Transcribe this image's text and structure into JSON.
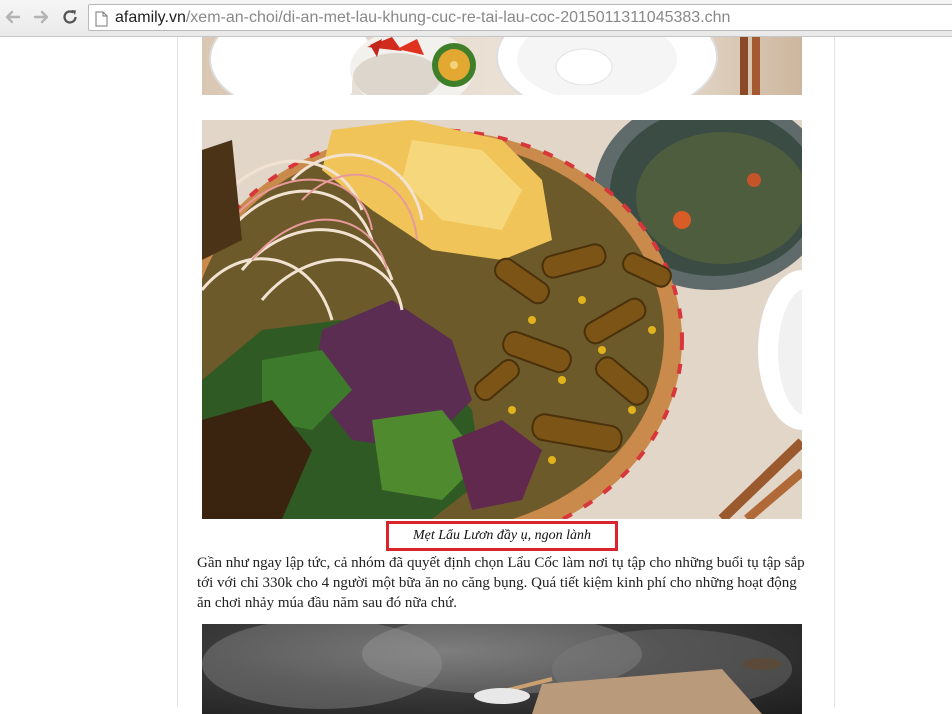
{
  "browser": {
    "url_domain": "afamily.vn",
    "url_path": "/xem-an-choi/di-an-met-lau-khung-cuc-re-tai-lau-coc-2015011311045383.chn",
    "icons": {
      "back": "back-arrow-icon",
      "forward": "forward-arrow-icon",
      "reload": "reload-icon",
      "page": "page-icon"
    }
  },
  "article": {
    "caption": "Mẹt Lẩu Lươn đầy ụ, ngon lành",
    "paragraph": "Gần như ngay lập tức, cả nhóm đã quyết định chọn Lẩu Cốc làm nơi tụ tập cho những buổi tụ tập sắp tới với chỉ 330k cho 4 người một bữa ăn no căng bụng. Quá tiết kiệm kinh phí cho những hoạt động ăn chơi nhảy múa đầu năm sau đó nữa chứ."
  },
  "colors": {
    "highlight_box": "#d9232d",
    "url_domain": "#222222",
    "url_path": "#888888"
  }
}
